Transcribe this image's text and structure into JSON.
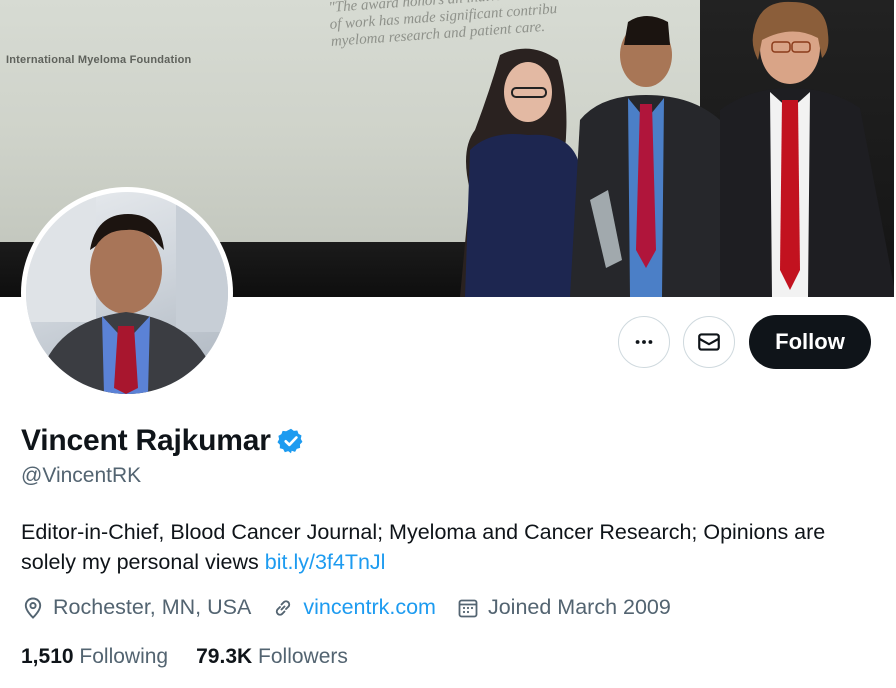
{
  "banner": {
    "org_text": "International Myeloma Foundation",
    "quote_lines": [
      "\"The award honors an individual who",
      "of work has made significant contribu",
      "myeloma research and patient care."
    ]
  },
  "actions": {
    "more_icon": "more-horizontal-icon",
    "message_icon": "envelope-icon",
    "follow_label": "Follow"
  },
  "profile": {
    "name": "Vincent Rajkumar",
    "verified_icon": "verified-badge-icon",
    "handle": "@VincentRK",
    "bio_text": "Editor-in-Chief, Blood Cancer Journal; Myeloma and Cancer Research; Opinions are solely my personal views ",
    "bio_link": "bit.ly/3f4TnJl",
    "location": "Rochester, MN, USA",
    "website": "vincentrk.com",
    "joined": "Joined March 2009",
    "following_count": "1,510",
    "following_label": "Following",
    "followers_count": "79.3K",
    "followers_label": "Followers"
  },
  "colors": {
    "text_primary": "#0f1419",
    "text_secondary": "#536471",
    "link": "#1d9bf0",
    "verified": "#1d9bf0",
    "follow_button_bg": "#0f1419"
  }
}
